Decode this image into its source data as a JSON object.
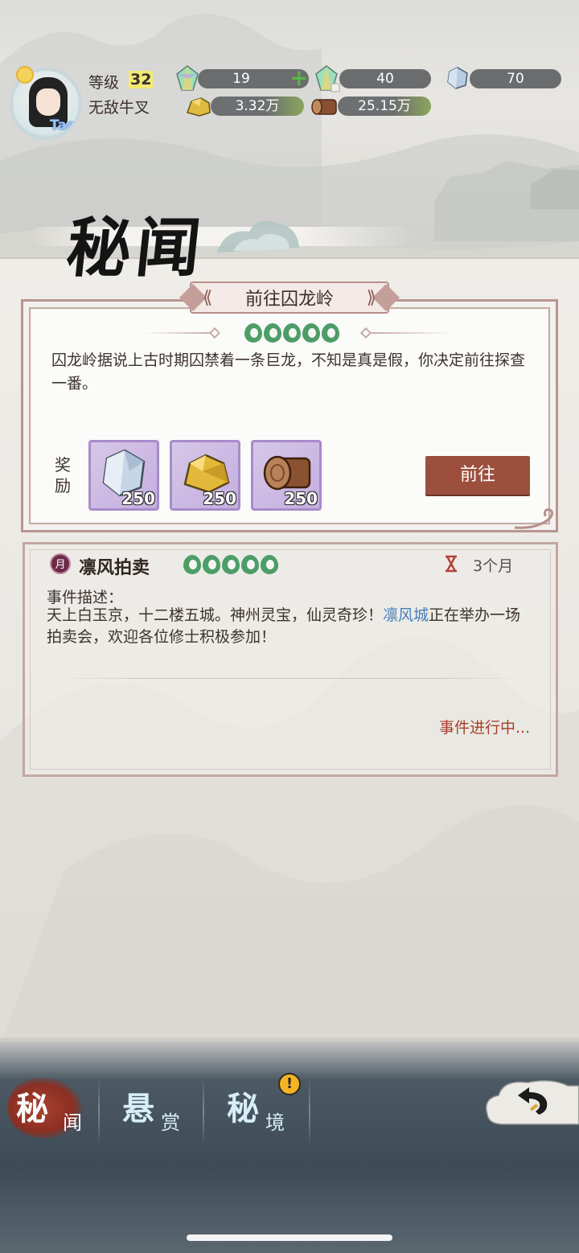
{
  "player": {
    "level_label": "等级",
    "level": "32",
    "name": "无敌牛叉",
    "avatar_tap": "Tap"
  },
  "resources": [
    {
      "icon": "rainbow-crystal-icon",
      "value": "19",
      "has_plus": true
    },
    {
      "icon": "rainbow-crystal-ticket-icon",
      "value": "40"
    },
    {
      "icon": "spirit-stone-icon",
      "value": "70"
    },
    {
      "icon": "gold-ore-icon",
      "value": "3.32万"
    },
    {
      "icon": "wood-log-icon",
      "value": "25.15万"
    }
  ],
  "page_title": "秘闻",
  "quest": {
    "banner": "前往囚龙岭",
    "difficulty_count": 5,
    "description": "囚龙岭据说上古时期囚禁着一条巨龙，不知是真是假，你决定前往探查一番。",
    "reward_label": "奖励",
    "rewards": [
      {
        "icon": "spirit-stone-icon",
        "qty": "250"
      },
      {
        "icon": "gold-ore-icon",
        "qty": "250"
      },
      {
        "icon": "wood-log-icon",
        "qty": "250"
      }
    ],
    "go_button": "前往"
  },
  "event": {
    "badge": "月",
    "title": "凛风拍卖",
    "difficulty_count": 5,
    "duration": "3个月",
    "desc_label": "事件描述：",
    "desc_part1": "天上白玉京，十二楼五城。神州灵宝，仙灵奇珍！",
    "desc_city": "凛风城",
    "desc_part2": "正在举办一场拍卖会，欢迎各位修士积极参加！",
    "status": "事件进行中..."
  },
  "nav": {
    "tab1_big": "秘",
    "tab1_small": "闻",
    "tab2_big": "悬",
    "tab2_small": "赏",
    "tab3_big": "秘",
    "tab3_small": "境",
    "tab3_alert": "!"
  },
  "colors": {
    "accent_button": "#9c4f3c",
    "difficulty_green": "#4c9d67",
    "city_link": "#4a7eb8",
    "status_red": "#a8402e"
  }
}
